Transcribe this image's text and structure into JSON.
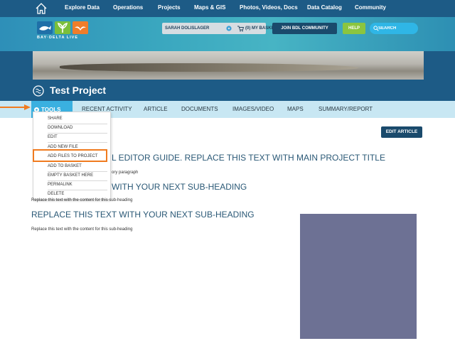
{
  "nav": {
    "items": [
      "Explore Data",
      "Operations",
      "Projects",
      "Maps & GIS",
      "Photos, Videos, Docs",
      "Data Catalog",
      "Community"
    ]
  },
  "brand": {
    "logo_text": "BAY·DELTA LIVE"
  },
  "header": {
    "user": "SARAH DOLISLAGER",
    "basket": "(0) MY BASKET",
    "join": "JOIN BDL COMMUNITY",
    "help": "HELP",
    "search_placeholder": "SEARCH"
  },
  "project": {
    "title": "Test Project"
  },
  "tabs": {
    "tools": "TOOLS",
    "items": [
      "RECENT ACTIVITY",
      "ARTICLE",
      "DOCUMENTS",
      "IMAGES/VIDEO",
      "MAPS",
      "SUMMARY/REPORT"
    ]
  },
  "tools_menu": {
    "items": [
      "SHARE",
      "DOWNLOAD",
      "EDIT",
      "ADD NEW FILE",
      "ADD FILES TO PROJECT",
      "ADD TO BASKET",
      "EMPTY BASKET HERE",
      "PERMALINK",
      "DELETE"
    ]
  },
  "article": {
    "edit_button": "EDIT ARTICLE",
    "heading_main": "L EDITOR GUIDE. REPLACE THIS TEXT WITH MAIN PROJECT TITLE",
    "intro": "ory paragraph",
    "subheading_1": "WITH YOUR NEXT SUB-HEADING",
    "paragraph_1": "Replace this text with the content for this sub-heading",
    "subheading_2": "REPLACE THIS TEXT WITH YOUR NEXT SUB-HEADING",
    "paragraph_2": "Replace this text with the content for this sub-heading"
  },
  "colors": {
    "nav": "#1d5b86",
    "tab_active": "#3ab0e0",
    "tab_bar": "#c8e7f3",
    "help": "#8bc53f",
    "highlight": "#f07b1f",
    "heading": "#2a5876"
  }
}
